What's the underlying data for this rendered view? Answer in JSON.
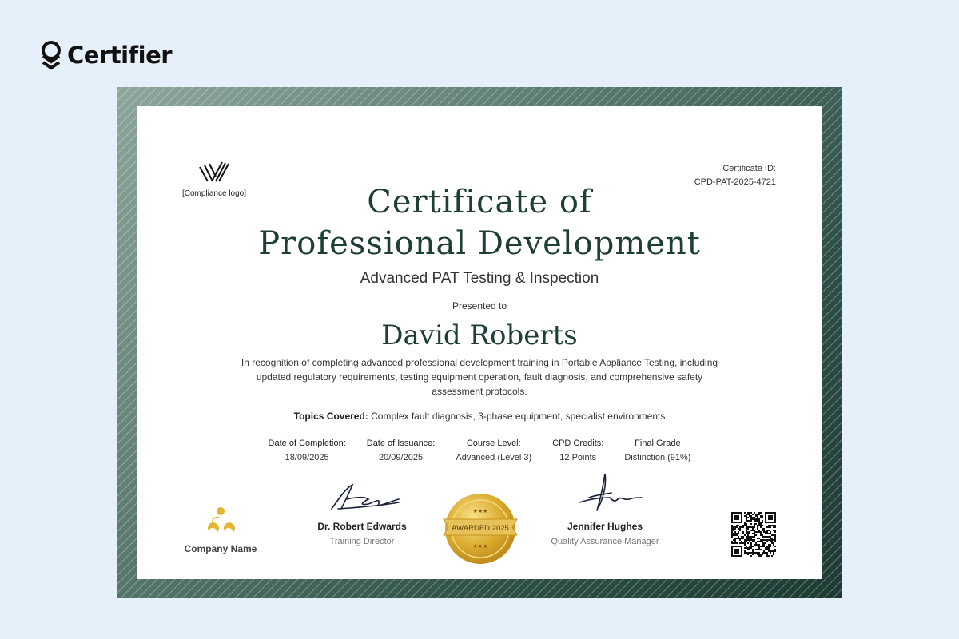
{
  "brand": {
    "name": "Certifier"
  },
  "certificate": {
    "logo_label": "[Compliance logo]",
    "id_label": "Certificate ID:",
    "id_value": "CPD-PAT-2025-4721",
    "title_line1": "Certificate of",
    "title_line2": "Professional Development",
    "subtitle": "Advanced PAT Testing & Inspection",
    "presented_to": "Presented to",
    "recipient": "David Roberts",
    "description": "In recognition of completing advanced professional development training in Portable Appliance Testing, including updated regulatory requirements, testing equipment operation, fault diagnosis, and comprehensive safety assessment protocols.",
    "topics_label": "Topics Covered:",
    "topics_value": "Complex fault diagnosis, 3-phase equipment, specialist environments",
    "details": [
      {
        "label": "Date of Completion:",
        "value": "18/09/2025"
      },
      {
        "label": "Date of Issuance:",
        "value": "20/09/2025"
      },
      {
        "label": "Course Level:",
        "value": "Advanced (Level 3)"
      },
      {
        "label": "CPD Credits:",
        "value": "12 Points"
      },
      {
        "label": "Final Grade",
        "value": "Distinction (91%)"
      }
    ],
    "company_name": "Company Name",
    "signatories": [
      {
        "name": "Dr. Robert Edwards",
        "role": "Training Director"
      },
      {
        "name": "Jennifer Hughes",
        "role": "Quality Assurance Manager"
      }
    ],
    "seal_text": "AWARDED 2025"
  },
  "colors": {
    "background": "#e6f0fb",
    "frame_dark": "#1d3a33",
    "title": "#1e3f36",
    "gold": "#d9b13a"
  }
}
